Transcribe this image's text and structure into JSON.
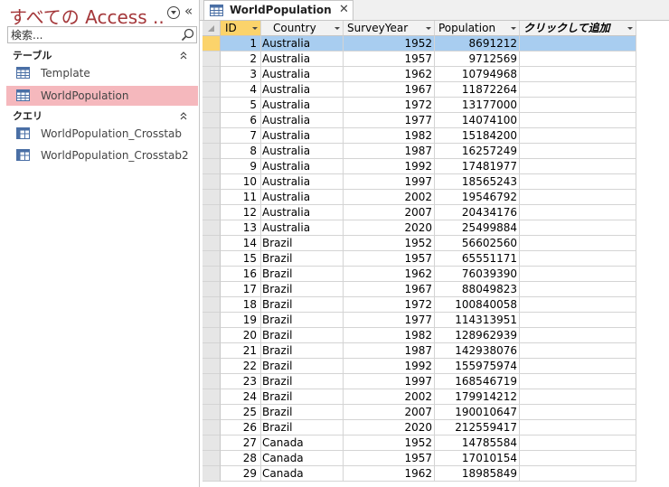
{
  "nav": {
    "title": "すべての Access ...",
    "collapse_glyph": "«",
    "search_placeholder": "検索...",
    "groups": [
      {
        "label": "テーブル",
        "items": [
          {
            "label": "Template",
            "selected": false
          },
          {
            "label": "WorldPopulation",
            "selected": true
          }
        ]
      },
      {
        "label": "クエリ",
        "items": [
          {
            "label": "WorldPopulation_Crosstab",
            "selected": false
          },
          {
            "label": "WorldPopulation_Crosstab2",
            "selected": false
          }
        ]
      }
    ]
  },
  "tab": {
    "label": "WorldPopulation",
    "close_glyph": "✕"
  },
  "grid": {
    "headers": {
      "id": "ID",
      "country": "Country",
      "year": "SurveyYear",
      "population": "Population",
      "add": "クリックして追加"
    },
    "rows": [
      {
        "id": "1",
        "country": "Australia",
        "year": "1952",
        "population": "8691212"
      },
      {
        "id": "2",
        "country": "Australia",
        "year": "1957",
        "population": "9712569"
      },
      {
        "id": "3",
        "country": "Australia",
        "year": "1962",
        "population": "10794968"
      },
      {
        "id": "4",
        "country": "Australia",
        "year": "1967",
        "population": "11872264"
      },
      {
        "id": "5",
        "country": "Australia",
        "year": "1972",
        "population": "13177000"
      },
      {
        "id": "6",
        "country": "Australia",
        "year": "1977",
        "population": "14074100"
      },
      {
        "id": "7",
        "country": "Australia",
        "year": "1982",
        "population": "15184200"
      },
      {
        "id": "8",
        "country": "Australia",
        "year": "1987",
        "population": "16257249"
      },
      {
        "id": "9",
        "country": "Australia",
        "year": "1992",
        "population": "17481977"
      },
      {
        "id": "10",
        "country": "Australia",
        "year": "1997",
        "population": "18565243"
      },
      {
        "id": "11",
        "country": "Australia",
        "year": "2002",
        "population": "19546792"
      },
      {
        "id": "12",
        "country": "Australia",
        "year": "2007",
        "population": "20434176"
      },
      {
        "id": "13",
        "country": "Australia",
        "year": "2020",
        "population": "25499884"
      },
      {
        "id": "14",
        "country": "Brazil",
        "year": "1952",
        "population": "56602560"
      },
      {
        "id": "15",
        "country": "Brazil",
        "year": "1957",
        "population": "65551171"
      },
      {
        "id": "16",
        "country": "Brazil",
        "year": "1962",
        "population": "76039390"
      },
      {
        "id": "17",
        "country": "Brazil",
        "year": "1967",
        "population": "88049823"
      },
      {
        "id": "18",
        "country": "Brazil",
        "year": "1972",
        "population": "100840058"
      },
      {
        "id": "19",
        "country": "Brazil",
        "year": "1977",
        "population": "114313951"
      },
      {
        "id": "20",
        "country": "Brazil",
        "year": "1982",
        "population": "128962939"
      },
      {
        "id": "21",
        "country": "Brazil",
        "year": "1987",
        "population": "142938076"
      },
      {
        "id": "22",
        "country": "Brazil",
        "year": "1992",
        "population": "155975974"
      },
      {
        "id": "23",
        "country": "Brazil",
        "year": "1997",
        "population": "168546719"
      },
      {
        "id": "24",
        "country": "Brazil",
        "year": "2002",
        "population": "179914212"
      },
      {
        "id": "25",
        "country": "Brazil",
        "year": "2007",
        "population": "190010647"
      },
      {
        "id": "26",
        "country": "Brazil",
        "year": "2020",
        "population": "212559417"
      },
      {
        "id": "27",
        "country": "Canada",
        "year": "1952",
        "population": "14785584"
      },
      {
        "id": "28",
        "country": "Canada",
        "year": "1957",
        "population": "17010154"
      },
      {
        "id": "29",
        "country": "Canada",
        "year": "1962",
        "population": "18985849"
      }
    ],
    "current_row_id": "1"
  },
  "colors": {
    "accent_title": "#a4373a",
    "nav_selected": "#f5b8bd",
    "row_selected": "#a8cdf0",
    "current_indicator": "#fbd36b"
  }
}
